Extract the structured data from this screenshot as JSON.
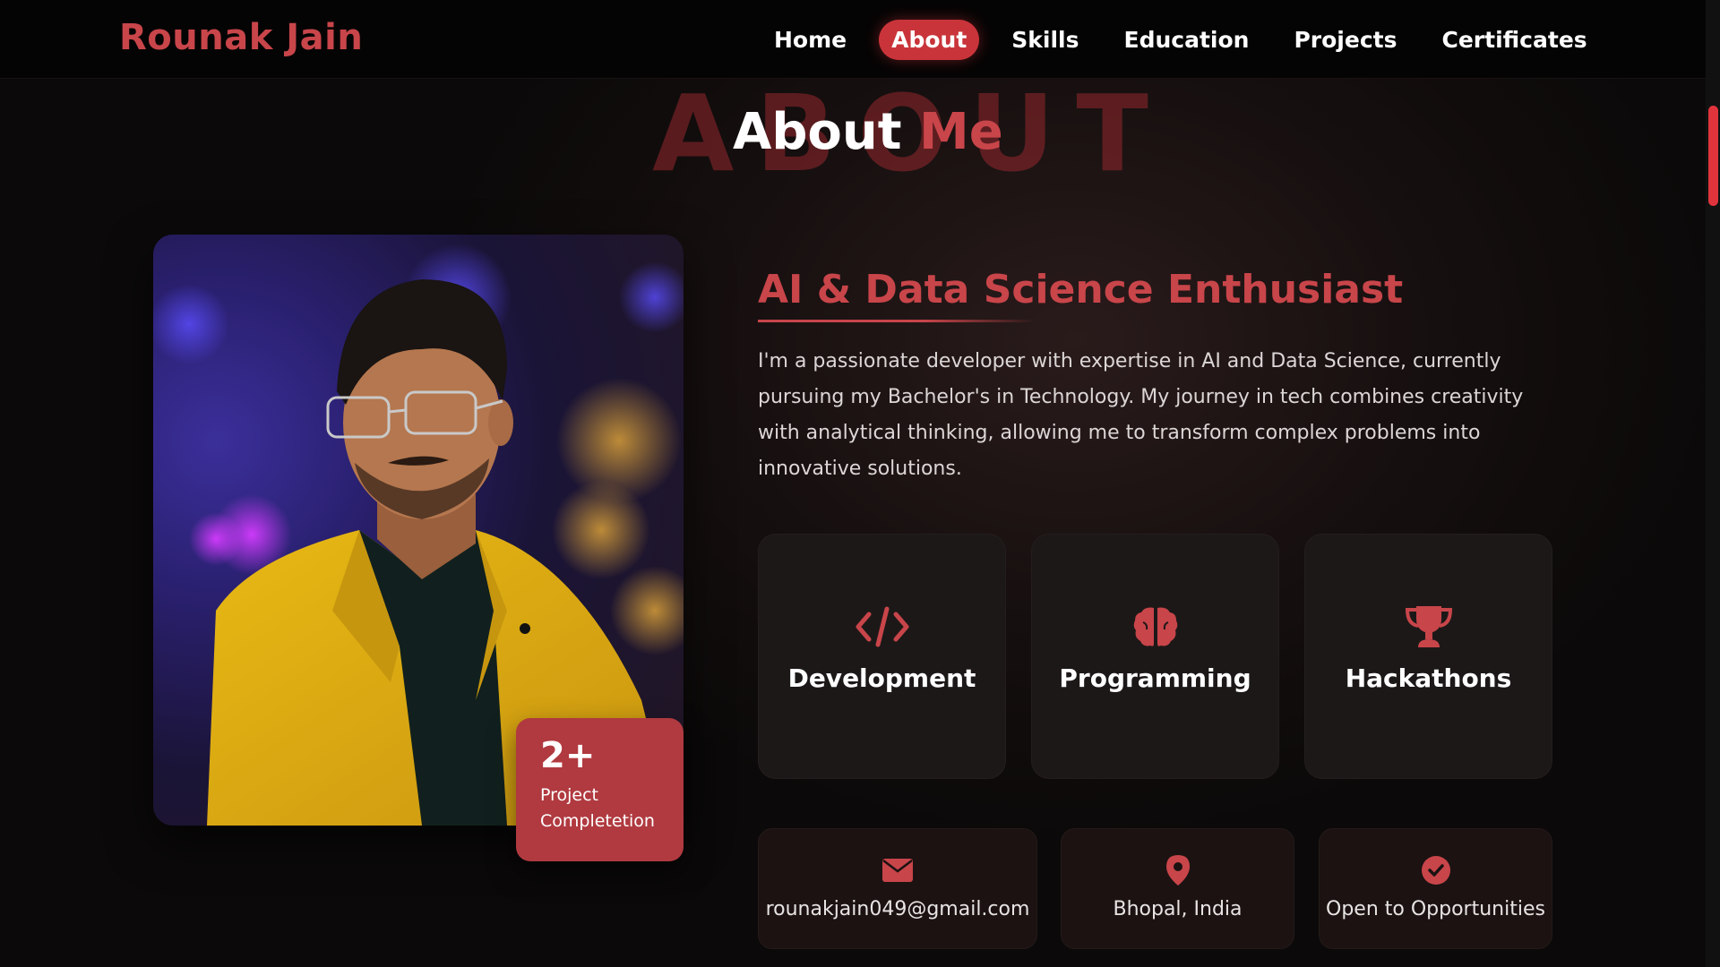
{
  "brand": "Rounak Jain",
  "nav": {
    "items": [
      "Home",
      "About",
      "Skills",
      "Education",
      "Projects",
      "Certificates"
    ],
    "active": "About"
  },
  "section": {
    "ghost_text": "ABOUT",
    "title_primary": "About",
    "title_accent": "Me"
  },
  "profile": {
    "stat_value": "2+",
    "stat_label": "Project Completetion"
  },
  "about": {
    "subtitle": "AI & Data Science Enthusiast",
    "bio": "I'm a passionate developer with expertise in AI and Data Science, currently pursuing my Bachelor's in Technology. My journey in tech combines creativity with analytical thinking, allowing me to transform complex problems into innovative solutions."
  },
  "features": [
    {
      "icon": "code-icon",
      "label": "Development"
    },
    {
      "icon": "brain-icon",
      "label": "Programming"
    },
    {
      "icon": "trophy-icon",
      "label": "Hackathons"
    }
  ],
  "info": [
    {
      "icon": "envelope-icon",
      "label": "rounakjain049@gmail.com"
    },
    {
      "icon": "map-pin-icon",
      "label": "Bhopal, India"
    },
    {
      "icon": "check-circle-icon",
      "label": "Open to Opportunities"
    }
  ],
  "colors": {
    "accent": "#c8454a",
    "nav_active_bg": "#c9343a",
    "stat_card_bg": "#b03a40",
    "background": "#0b0909",
    "scrollbar_thumb": "#e0343d"
  }
}
